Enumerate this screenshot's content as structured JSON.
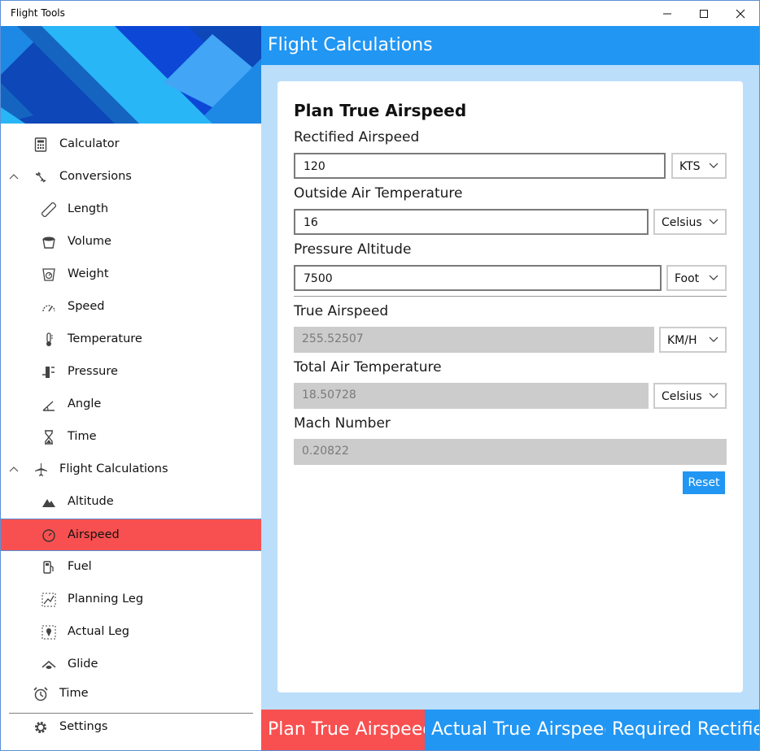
{
  "window": {
    "title": "Flight Tools"
  },
  "sidebar": {
    "items": [
      {
        "label": "Calculator",
        "icon": "calculator-icon"
      },
      {
        "label": "Conversions",
        "icon": "conversions-icon"
      },
      {
        "label": "Length",
        "icon": "ruler-icon"
      },
      {
        "label": "Volume",
        "icon": "bucket-icon"
      },
      {
        "label": "Weight",
        "icon": "scale-icon"
      },
      {
        "label": "Speed",
        "icon": "speedometer-icon"
      },
      {
        "label": "Temperature",
        "icon": "thermometer-icon"
      },
      {
        "label": "Pressure",
        "icon": "pressure-icon"
      },
      {
        "label": "Angle",
        "icon": "angle-icon"
      },
      {
        "label": "Time",
        "icon": "hourglass-icon"
      },
      {
        "label": "Flight Calculations",
        "icon": "airplane-icon"
      },
      {
        "label": "Altitude",
        "icon": "mountain-icon"
      },
      {
        "label": "Airspeed",
        "icon": "gauge-icon"
      },
      {
        "label": "Fuel",
        "icon": "fuel-pump-icon"
      },
      {
        "label": "Planning Leg",
        "icon": "map-route-icon"
      },
      {
        "label": "Actual Leg",
        "icon": "map-pin-icon"
      },
      {
        "label": "Glide",
        "icon": "glider-icon"
      },
      {
        "label": "Time",
        "icon": "alarm-clock-icon"
      }
    ],
    "settings_label": "Settings",
    "selected": "Airspeed"
  },
  "header": {
    "title": "Flight Calculations"
  },
  "form": {
    "title": "Plan True Airspeed",
    "rectified": {
      "label": "Rectified Airspeed",
      "value": "120",
      "unit": "KTS"
    },
    "oat": {
      "label": "Outside Air Temperature",
      "value": "16",
      "unit": "Celsius"
    },
    "pressure_alt": {
      "label": "Pressure Altitude",
      "value": "7500",
      "unit": "Foot"
    },
    "true_airspeed": {
      "label": "True Airspeed",
      "value": "255.52507",
      "unit": "KM/H"
    },
    "tat": {
      "label": "Total Air Temperature",
      "value": "18.50728",
      "unit": "Celsius"
    },
    "mach": {
      "label": "Mach Number",
      "value": "0.20822"
    },
    "reset_label": "Reset"
  },
  "tabs": [
    {
      "label": "Plan True Airspeed",
      "active": true
    },
    {
      "label": "Actual True Airspeed",
      "active": false
    },
    {
      "label": "Required Rectified",
      "active": false
    }
  ],
  "colors": {
    "accent": "#2196f3",
    "selected": "#f85050",
    "main_bg": "#bbdefb"
  }
}
